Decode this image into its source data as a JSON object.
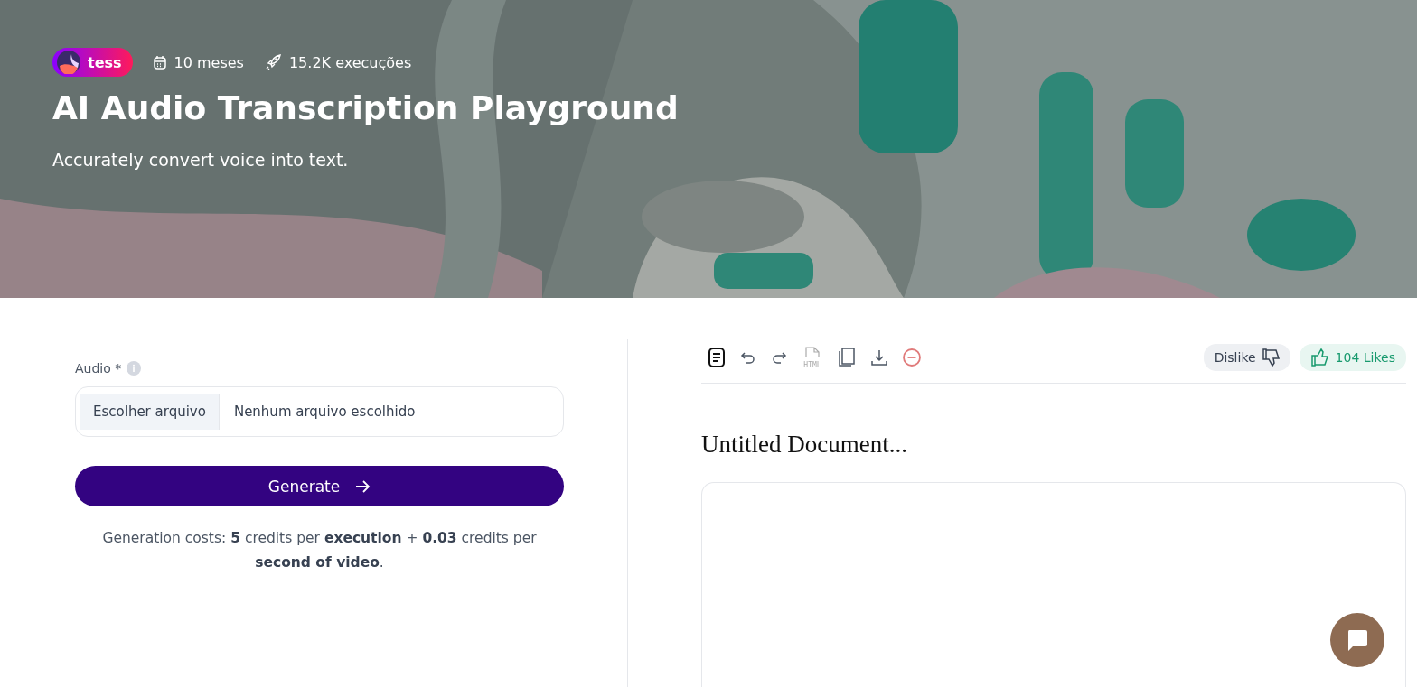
{
  "hero": {
    "kind": "picture",
    "author": "tess",
    "meta": [
      {
        "kind": "calendar",
        "text": "10 meses"
      },
      {
        "kind": "rocket",
        "text": "15.2K execuções"
      }
    ],
    "title": "AI Audio Transcription Playground",
    "subtitle": "Accurately convert voice into text."
  },
  "form": {
    "label": "Audio *",
    "file_button": "Escolher arquivo",
    "file_status": "Nenhum arquivo escolhido",
    "generate": "Generate",
    "cost_note": "Generation costs: **5** credits per **execution** + **0.03** credits per **second of video**."
  },
  "editor": {
    "toolbar": [
      {
        "kind": "document"
      },
      {
        "kind": "undo"
      },
      {
        "kind": "redo"
      },
      {
        "kind": "html",
        "text": "HTML"
      },
      {
        "kind": "copy"
      },
      {
        "kind": "download"
      },
      {
        "kind": "clear"
      }
    ],
    "dislike": "Dislike",
    "likes": "104 Likes",
    "doc_title": "Untitled Document..."
  }
}
